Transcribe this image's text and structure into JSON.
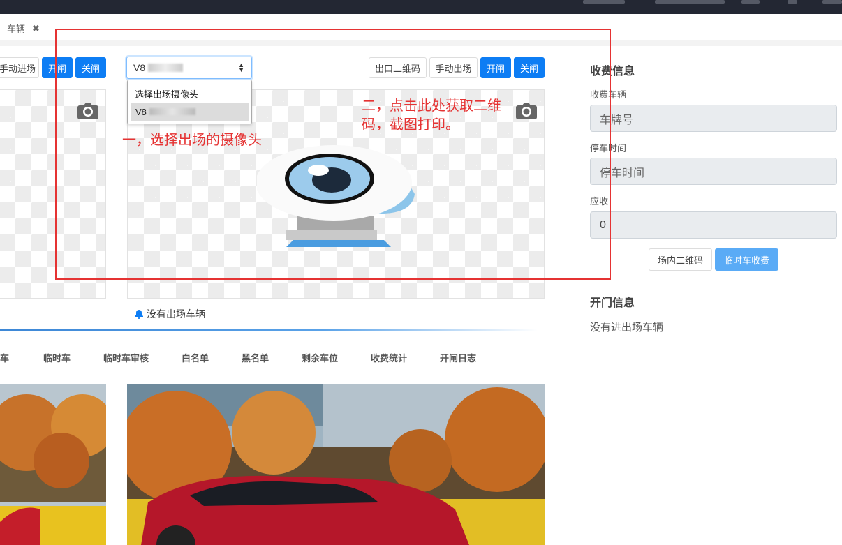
{
  "tab": {
    "label": "车辆",
    "close": "✖"
  },
  "left_toolbar": {
    "manual_entry": "手动进场",
    "open": "开闸",
    "close": "关闸"
  },
  "camera_select": {
    "value": "V8",
    "options": [
      "选择出场摄像头",
      "V8"
    ]
  },
  "right_toolbar": {
    "exit_qr": "出口二维码",
    "manual_exit": "手动出场",
    "open": "开闸",
    "close": "关闸"
  },
  "annotations": {
    "step1": "一，选择出场的摄像头",
    "step2": "二，点击此处获取二维码，截图打印。"
  },
  "notice": {
    "text": "没有出场车辆"
  },
  "nav_tabs": [
    "月租车",
    "临时车",
    "临时车审核",
    "白名单",
    "黑名单",
    "剩余车位",
    "收费统计",
    "开闸日志"
  ],
  "fee_panel": {
    "title": "收费信息",
    "plate_label": "收费车辆",
    "plate_placeholder": "车牌号",
    "time_label": "停车时间",
    "time_placeholder": "停车时间",
    "due_label": "应收",
    "due_value": "0",
    "qr_button": "场内二维码",
    "charge_button": "临时车收费"
  },
  "gate_panel": {
    "title": "开门信息",
    "text": "没有进出场车辆"
  },
  "colors": {
    "primary": "#0d7df4",
    "annotation_red": "#e53333",
    "disabled_input": "#e9ecef"
  }
}
